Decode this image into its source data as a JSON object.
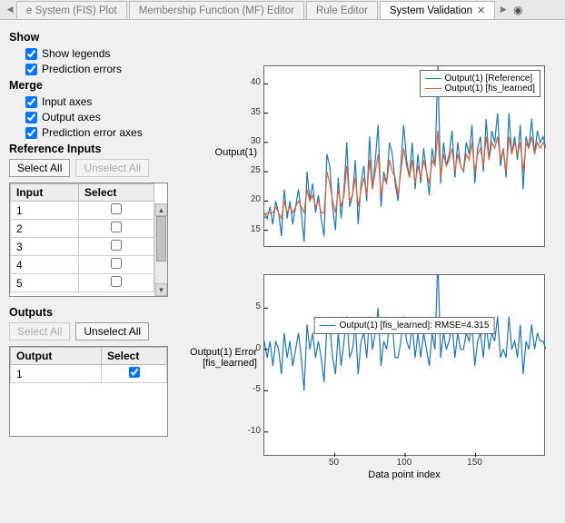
{
  "tabs": {
    "nav_prev_glyph": "◀",
    "items": [
      {
        "label": "e System (FIS) Plot",
        "closable": false,
        "active": false
      },
      {
        "label": "Membership Function (MF) Editor",
        "closable": false,
        "active": false
      },
      {
        "label": "Rule Editor",
        "closable": false,
        "active": false
      },
      {
        "label": "System Validation",
        "closable": true,
        "active": true
      }
    ],
    "nav_next_glyph": "▶",
    "extra_glyph": "◉"
  },
  "panel": {
    "show_title": "Show",
    "show_legends_label": "Show legends",
    "show_legends_checked": true,
    "pred_err_label": "Prediction errors",
    "pred_err_checked": true,
    "merge_title": "Merge",
    "input_axes_label": "Input axes",
    "input_axes_checked": true,
    "output_axes_label": "Output axes",
    "output_axes_checked": true,
    "pred_err_axes_label": "Prediction error axes",
    "pred_err_axes_checked": true,
    "ref_inputs_title": "Reference Inputs",
    "select_all_label": "Select All",
    "unselect_all_label": "Unselect All",
    "inputs_tbl": {
      "col_input": "Input",
      "col_select": "Select",
      "rows": [
        {
          "name": "1",
          "checked": false
        },
        {
          "name": "2",
          "checked": false
        },
        {
          "name": "3",
          "checked": false
        },
        {
          "name": "4",
          "checked": false
        },
        {
          "name": "5",
          "checked": false
        }
      ]
    },
    "outputs_title": "Outputs",
    "outputs_tbl": {
      "col_output": "Output",
      "col_select": "Select",
      "rows": [
        {
          "name": "1",
          "checked": true
        }
      ]
    }
  },
  "chart_data": [
    {
      "type": "line",
      "title": "",
      "ylabel": "Output(1)",
      "yticks": [
        15,
        20,
        25,
        30,
        35,
        40
      ],
      "ylim": [
        12,
        43
      ],
      "xlim": [
        0,
        200
      ],
      "legend_pos": "top-right",
      "series": [
        {
          "name": "Output(1) [Reference]",
          "color": "#1f77b4",
          "values": [
            18,
            17,
            19,
            16,
            20,
            18,
            14,
            22,
            17,
            20,
            16,
            19,
            22,
            18,
            13,
            25,
            20,
            23,
            18,
            21,
            17,
            14,
            28,
            26,
            19,
            15,
            24,
            17,
            22,
            30,
            19,
            21,
            27,
            16,
            23,
            26,
            20,
            31,
            22,
            27,
            33,
            19,
            25,
            23,
            30,
            28,
            23,
            20,
            26,
            33,
            27,
            24,
            30,
            22,
            28,
            23,
            29,
            25,
            21,
            29,
            26,
            43,
            23,
            30,
            26,
            28,
            32,
            24,
            30,
            26,
            25,
            30,
            28,
            33,
            23,
            29,
            31,
            25,
            34,
            27,
            32,
            30,
            35,
            26,
            29,
            24,
            35,
            28,
            31,
            27,
            33,
            22,
            31,
            29,
            34,
            28,
            32,
            30,
            31,
            29
          ]
        },
        {
          "name": "Output(1) [fis_learned]",
          "color": "#d9633a",
          "values": [
            17,
            18,
            18,
            18,
            19,
            18,
            17,
            20,
            18,
            19,
            18,
            19,
            20,
            19,
            18,
            22,
            20,
            21,
            19,
            20,
            18,
            18,
            25,
            23,
            20,
            18,
            22,
            19,
            21,
            26,
            20,
            21,
            24,
            19,
            22,
            24,
            21,
            27,
            22,
            25,
            28,
            21,
            24,
            23,
            27,
            25,
            24,
            21,
            25,
            29,
            26,
            24,
            27,
            23,
            26,
            24,
            27,
            25,
            23,
            27,
            26,
            32,
            24,
            28,
            26,
            27,
            29,
            25,
            28,
            26,
            25,
            28,
            27,
            30,
            25,
            28,
            29,
            26,
            31,
            27,
            30,
            29,
            31,
            27,
            29,
            25,
            31,
            28,
            30,
            28,
            30,
            25,
            30,
            29,
            31,
            28,
            30,
            29,
            30,
            29
          ]
        }
      ]
    },
    {
      "type": "line",
      "title": "",
      "ylabel": "Output(1) Error\n[fis_learned]",
      "xlabel": "Data point index",
      "yticks": [
        -10,
        -5,
        0,
        5
      ],
      "ylim": [
        -13,
        9
      ],
      "xticks": [
        50,
        100,
        150
      ],
      "xlim": [
        0,
        200
      ],
      "legend_pos": "center",
      "legend_label": "Output(1) [fis_learned]: RMSE=4.315",
      "series": [
        {
          "name": "error",
          "color": "#1f77b4",
          "values": [
            1,
            -1,
            1,
            -2,
            1,
            0,
            -3,
            2,
            -1,
            1,
            -2,
            0,
            2,
            -1,
            -5,
            3,
            0,
            2,
            -1,
            1,
            -1,
            -4,
            3,
            3,
            -1,
            -3,
            2,
            -2,
            1,
            4,
            -1,
            0,
            3,
            -3,
            1,
            2,
            -1,
            4,
            0,
            2,
            5,
            -2,
            1,
            0,
            3,
            3,
            -1,
            -1,
            1,
            4,
            1,
            0,
            3,
            -1,
            2,
            -1,
            2,
            0,
            -2,
            2,
            0,
            11,
            -1,
            2,
            0,
            1,
            3,
            -1,
            2,
            0,
            0,
            2,
            1,
            3,
            -2,
            1,
            2,
            -1,
            3,
            0,
            2,
            1,
            4,
            -1,
            0,
            -1,
            4,
            0,
            1,
            -1,
            3,
            -3,
            1,
            0,
            3,
            0,
            2,
            1,
            1,
            0
          ]
        }
      ]
    }
  ]
}
